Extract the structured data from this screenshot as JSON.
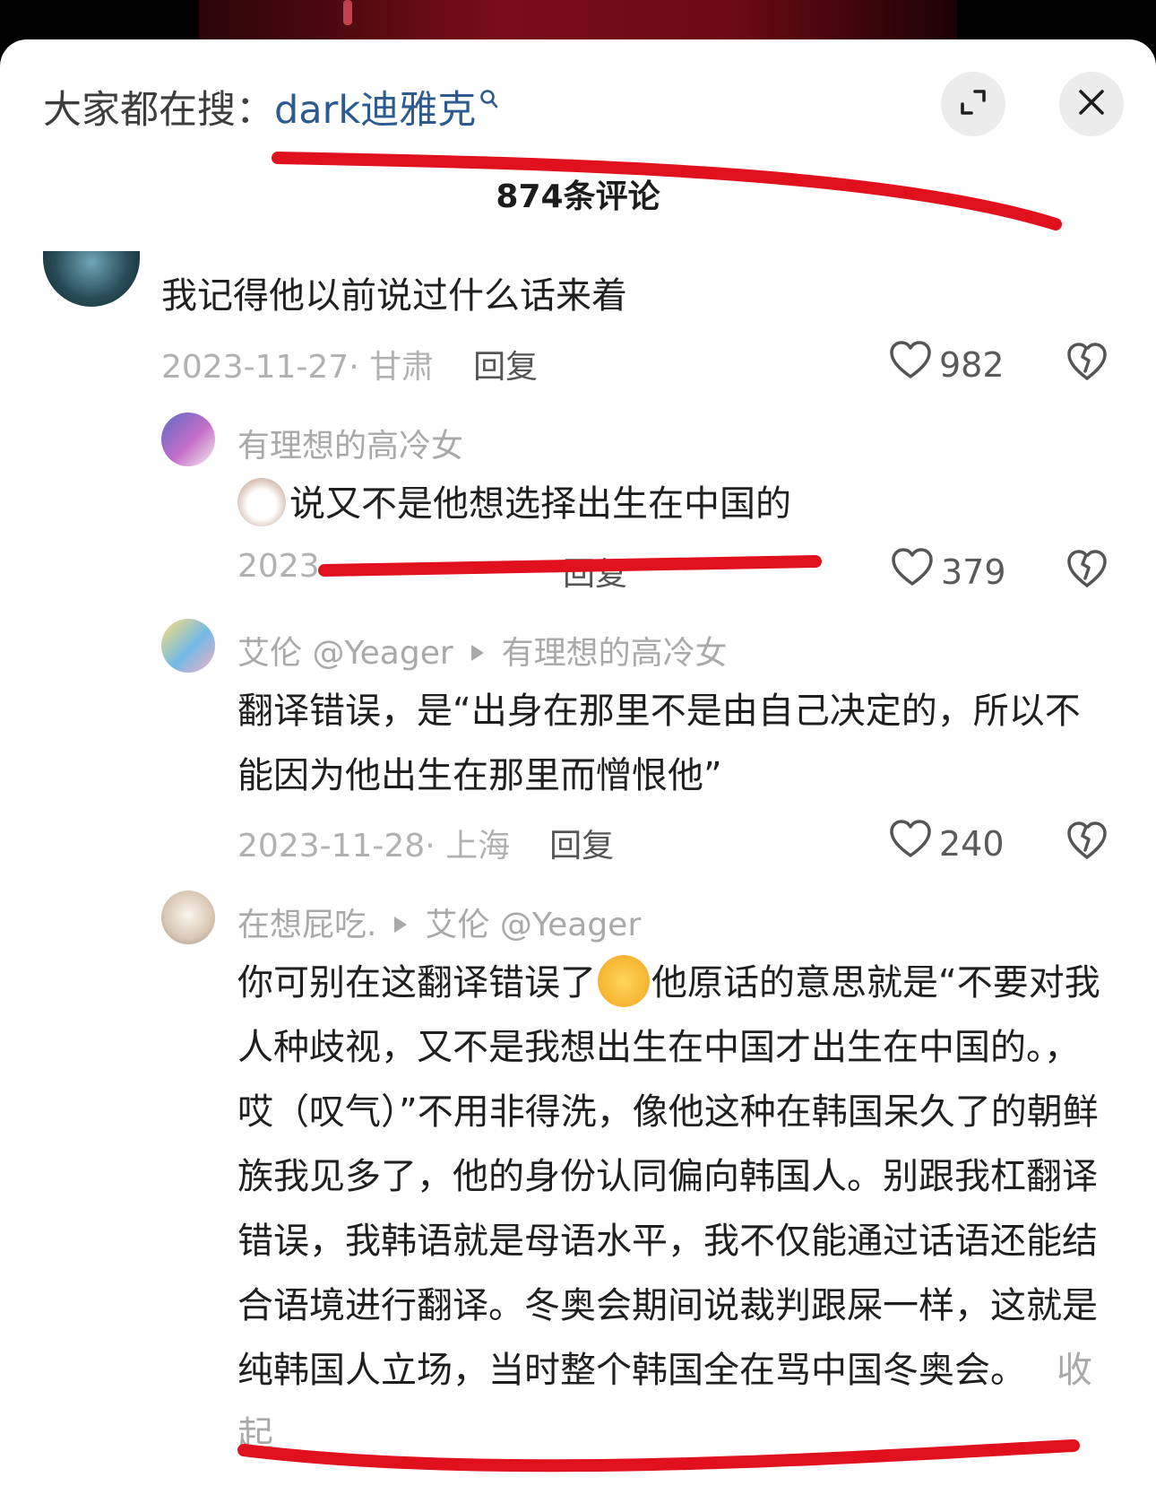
{
  "search": {
    "prefix": "大家都在搜：",
    "keyword": "dark迪雅克",
    "icon": "search-icon"
  },
  "buttons": {
    "expand_icon": "expand-icon",
    "close_icon": "close-icon"
  },
  "comment_count": "874条评论",
  "comments": [
    {
      "text": "我记得他以前说过什么话来着",
      "date": "2023-11-27",
      "location": "· 甘肃",
      "reply": "回复",
      "likes": "982"
    },
    {
      "author": "有理想的高冷女",
      "text": "说又不是他想选择出生在中国的",
      "emoji": "cat-emoji",
      "date": "2023",
      "reply": "回复",
      "likes": "379"
    },
    {
      "author": "艾伦 @Yeager",
      "reply_to": "有理想的高冷女",
      "text": "翻译错误，是“出身在那里不是由自己决定的，所以不能因为他出生在那里而憎恨他”",
      "date": "2023-11-28",
      "location": "· 上海",
      "reply": "回复",
      "likes": "240"
    },
    {
      "author": "在想屁吃.",
      "reply_to": "艾伦 @Yeager",
      "text_before_emoji": "你可别在这翻译错误了",
      "emoji": "sweat-smile-emoji",
      "text_after_emoji": "他原话的意思就是“不要对我人种歧视，又不是我想出生在中国才出生在中国的。，哎（叹气）”不用非得洗，像他这种在韩国呆久了的朝鲜族我见多了，他的身份认同偏向韩国人。别跟我杠翻译错误，我韩语就是母语水平，我不仅能通过话语还能结合语境进行翻译。冬奥会期间说裁判跟屎一样，这就是纯韩国人立场，当时整个韩国全在骂中国冬奥会。",
      "collapse": "收起"
    }
  ],
  "colors": {
    "keyword": "#2d5b8f",
    "annotation_stroke": "#e0101c",
    "meta_gray": "#b1b1b1"
  }
}
